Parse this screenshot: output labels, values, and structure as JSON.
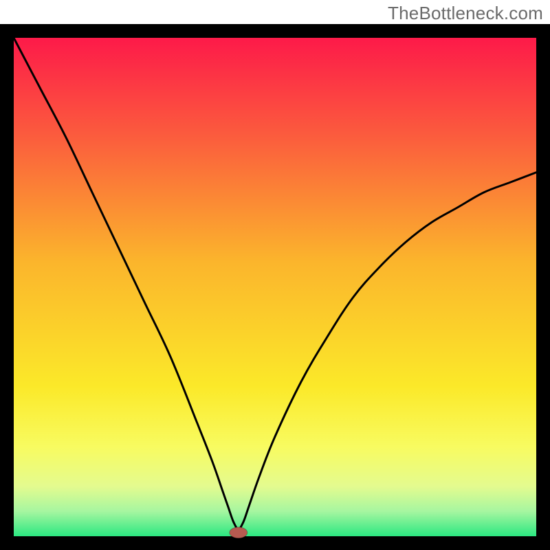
{
  "watermark": "TheBottleneck.com",
  "chart_data": {
    "type": "line",
    "title": "",
    "xlabel": "",
    "ylabel": "",
    "xlim": [
      0,
      100
    ],
    "ylim": [
      0,
      100
    ],
    "grid": false,
    "legend": false,
    "note": "Background is a RYG vertical gradient (red top, green bottom). A single black V-shaped curve with minimum near x≈43. A small red/brown lozenge marker sits at the minimum.",
    "series": [
      {
        "name": "bottleneck-curve",
        "x": [
          0,
          5,
          10,
          15,
          20,
          25,
          30,
          35,
          38,
          40,
          41,
          42,
          43,
          44,
          45,
          47,
          50,
          55,
          60,
          65,
          70,
          75,
          80,
          85,
          90,
          95,
          100
        ],
        "y": [
          100,
          90,
          80,
          69,
          58,
          47,
          36,
          23,
          15,
          9,
          6,
          3,
          1,
          3,
          6,
          12,
          20,
          31,
          40,
          48,
          54,
          59,
          63,
          66,
          69,
          71,
          73
        ]
      }
    ],
    "marker": {
      "x": 43,
      "y": 1,
      "color": "#b65a50"
    },
    "gradient_stops": [
      {
        "offset": 0.0,
        "color": "#fd1a49"
      },
      {
        "offset": 0.2,
        "color": "#fb5d3d"
      },
      {
        "offset": 0.45,
        "color": "#fbb52c"
      },
      {
        "offset": 0.7,
        "color": "#fbe929"
      },
      {
        "offset": 0.82,
        "color": "#f8fb60"
      },
      {
        "offset": 0.9,
        "color": "#e4fb8f"
      },
      {
        "offset": 0.95,
        "color": "#a6f6a0"
      },
      {
        "offset": 1.0,
        "color": "#2be781"
      }
    ],
    "frame": {
      "outer": 800,
      "border": 20,
      "top_gap": 35
    }
  }
}
